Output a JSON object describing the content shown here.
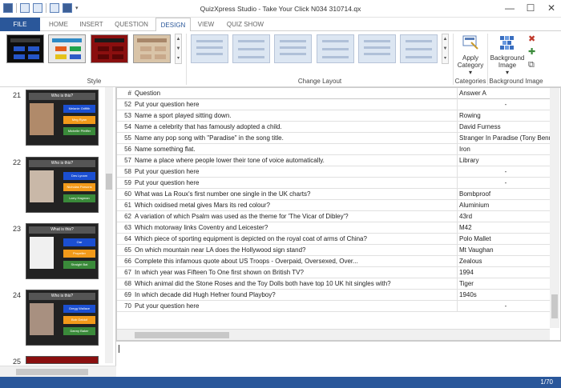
{
  "window": {
    "title": "QuizXpress Studio - Take Your Click N034 310714.qx",
    "minimize": "—",
    "maximize": "☐",
    "close": "✕"
  },
  "tabs": [
    {
      "label": "FILE"
    },
    {
      "label": "HOME"
    },
    {
      "label": "INSERT"
    },
    {
      "label": "QUESTION"
    },
    {
      "label": "DESIGN"
    },
    {
      "label": "VIEW"
    },
    {
      "label": "QUIZ SHOW"
    }
  ],
  "ribbon": {
    "style_label": "Style",
    "change_layout_label": "Change Layout",
    "categories_label": "Categories",
    "background_image_label": "Background Image",
    "apply_category": "Apply Category",
    "background_image_btn": "Background Image"
  },
  "colors": {
    "accent": "#2a579a",
    "red": "#c0392b",
    "green": "#3a8a3a",
    "orange": "#f29a1a",
    "blue": "#1b4fd1"
  },
  "slides": [
    {
      "num": "21",
      "question": "Who is this?",
      "answers": [
        "Melanie Griffith",
        "Meg Ryan",
        "Michelle Pfeiffer"
      ]
    },
    {
      "num": "22",
      "question": "Who is this?",
      "answers": [
        "Des Lynam",
        "Nicholas Parsons",
        "Larry Hagman"
      ]
    },
    {
      "num": "23",
      "question": "What is this?",
      "answers": [
        "Oar",
        "Propeller",
        "Straight Bat"
      ]
    },
    {
      "num": "24",
      "question": "Who is this?",
      "answers": [
        "Gregg Wallace",
        "Bob Geldof",
        "Danny Baker"
      ]
    },
    {
      "num": "25"
    }
  ],
  "grid": {
    "headers": {
      "num": "#",
      "question": "Question",
      "answer": "Answer A"
    },
    "rows": [
      {
        "num": "52",
        "q": "Put your question here",
        "a": "-"
      },
      {
        "num": "53",
        "q": "Name a sport played sitting down.",
        "a": "Rowing"
      },
      {
        "num": "54",
        "q": "Name a celebrity that has famously adopted a child.",
        "a": "David Furness"
      },
      {
        "num": "55",
        "q": "Name any pop song with \"Paradise\" in the song title.",
        "a": "Stranger In Paradise (Tony Benne"
      },
      {
        "num": "56",
        "q": "Name something flat.",
        "a": "Iron"
      },
      {
        "num": "57",
        "q": "Name a place where people lower their tone of voice automatically.",
        "a": "Library"
      },
      {
        "num": "58",
        "q": "Put your question here",
        "a": "-"
      },
      {
        "num": "59",
        "q": "Put your question here",
        "a": "-"
      },
      {
        "num": "60",
        "q": "What was La Roux's first number one single in the UK charts?",
        "a": "Bombproof"
      },
      {
        "num": "61",
        "q": "Which oxidised metal gives Mars its red colour?",
        "a": "Aluminium"
      },
      {
        "num": "62",
        "q": "A variation of which Psalm was used as the theme for 'The Vicar of Dibley'?",
        "a": "43rd"
      },
      {
        "num": "63",
        "q": "Which motorway links Coventry and Leicester?",
        "a": "M42"
      },
      {
        "num": "64",
        "q": "Which piece of sporting equipment is depicted on the royal coat of arms of China?",
        "a": "Polo Mallet"
      },
      {
        "num": "65",
        "q": "On which mountain near LA does the Hollywood sign stand?",
        "a": "Mt Vaughan"
      },
      {
        "num": "66",
        "q": "Complete this infamous quote about US Troops - Overpaid, Oversexed, Over...",
        "a": "Zealous"
      },
      {
        "num": "67",
        "q": "In which year was Fifteen To One first shown on British TV?",
        "a": "1994"
      },
      {
        "num": "68",
        "q": "Which animal did the Stone Roses and the Toy Dolls both have top 10 UK hit singles with?",
        "a": "Tiger"
      },
      {
        "num": "69",
        "q": "In which decade did Hugh Hefner found Playboy?",
        "a": "1940s"
      },
      {
        "num": "70",
        "q": "Put your question here",
        "a": "-"
      }
    ]
  },
  "status": {
    "page": "1/70"
  }
}
